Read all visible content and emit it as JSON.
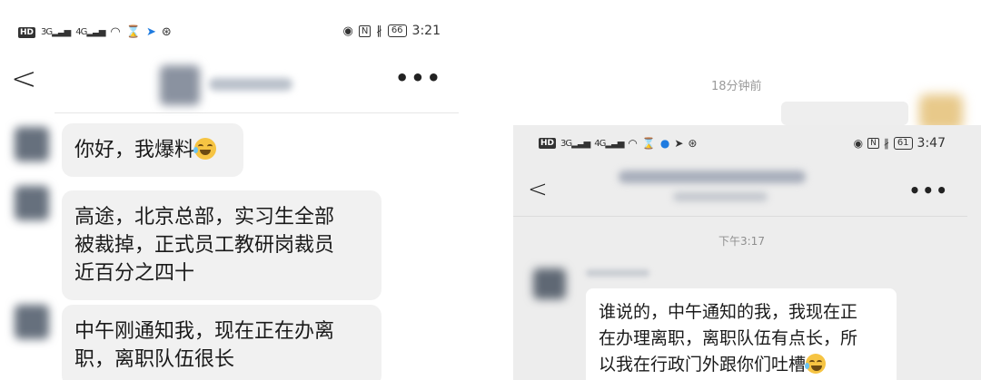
{
  "left": {
    "status": {
      "hd": "HD",
      "sig1": "3G",
      "sig2": "4G",
      "battery": "66",
      "time": "3:21"
    },
    "nav": {
      "back": "<",
      "more": "•••"
    },
    "messages": [
      {
        "text": "你好，我爆料",
        "emoji": "laughing-tears"
      },
      {
        "text": "高途，北京总部，实习生全部被裁掉，正式员工教研岗裁员近百分之四十"
      },
      {
        "text": "中午刚通知我，现在正在办离职，离职队伍很长"
      }
    ],
    "msg_lines": {
      "m1": "你好，我爆料",
      "m2_l1": "高途，北京总部，实习生全部",
      "m2_l2": "被裁掉，正式员工教研岗裁员",
      "m2_l3": "近百分之四十",
      "m3_l1": "中午刚通知我，现在正在办离",
      "m3_l2": "职，离职队伍很长"
    }
  },
  "right": {
    "top_time": "18分钟前",
    "inner": {
      "status": {
        "hd": "HD",
        "sig1": "3G",
        "sig2": "4G",
        "battery": "61",
        "time": "3:47"
      },
      "nav": {
        "back": "<",
        "more": "•••"
      },
      "time": "下午3:17",
      "message": {
        "l1": "谁说的，中午通知的我，我现在正",
        "l2": "在办理离职，离职队伍有点长，所",
        "l3": "以我在行政门外跟你们吐槽",
        "emoji": "laughing-tears"
      }
    }
  }
}
